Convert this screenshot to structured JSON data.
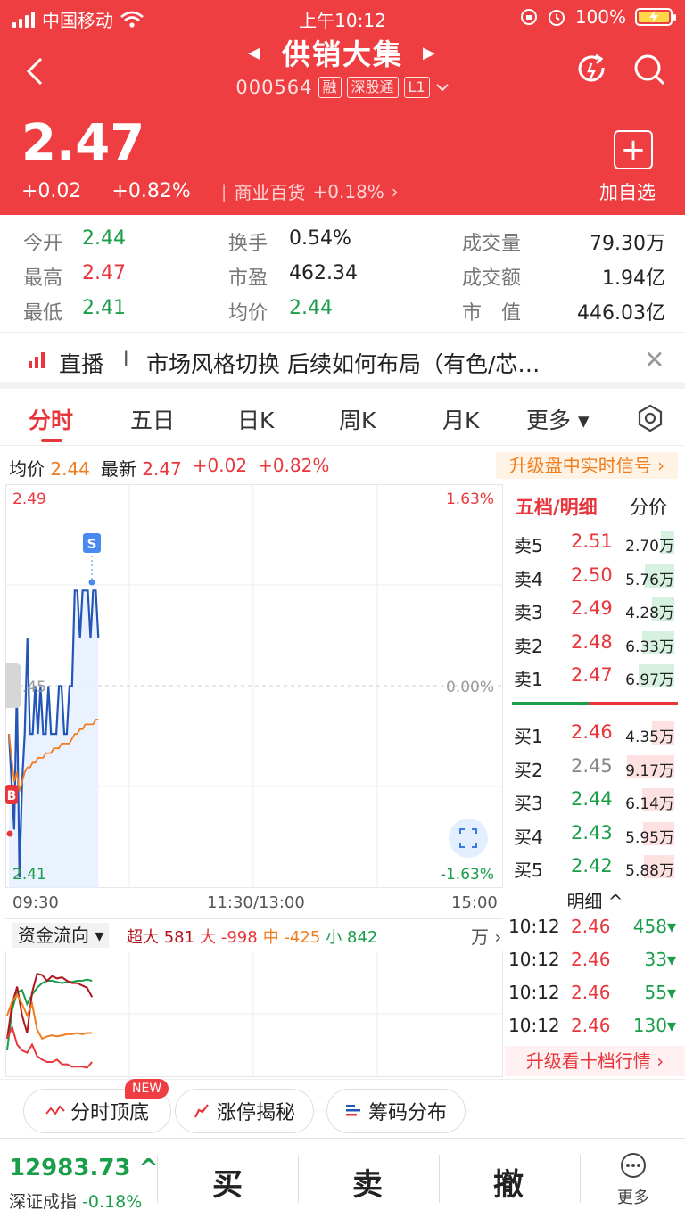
{
  "status": {
    "carrier": "中国移动",
    "time": "上午10:12",
    "battery": "100%"
  },
  "header": {
    "title": "供销大集",
    "code": "000564",
    "tags": [
      "融",
      "深股通",
      "L1"
    ],
    "price": "2.47",
    "change": "+0.02",
    "change_pct": "+0.82%",
    "sector": "商业百货",
    "sector_pct": "+0.18%",
    "add_label": "加自选",
    "add_glyph": "+"
  },
  "stats": [
    {
      "k": "今开",
      "v": "2.44",
      "color": "#1a9e4a"
    },
    {
      "k": "换手",
      "v": "0.54%",
      "color": "#222222"
    },
    {
      "k": "成交量",
      "v": "79.30万",
      "color": "#222222"
    },
    {
      "k": "最高",
      "v": "2.47",
      "color": "#e8363c"
    },
    {
      "k": "市盈",
      "v": "462.34",
      "color": "#222222"
    },
    {
      "k": "成交额",
      "v": "1.94亿",
      "color": "#222222"
    },
    {
      "k": "最低",
      "v": "2.41",
      "color": "#1a9e4a"
    },
    {
      "k": "均价",
      "v": "2.44",
      "color": "#1a9e4a"
    },
    {
      "k": "市　值",
      "v": "446.03亿",
      "color": "#222222"
    }
  ],
  "live": {
    "label": "直播",
    "text": "市场风格切换  后续如何布局（有色/芯…",
    "close": "✕"
  },
  "tabs": [
    "分时",
    "五日",
    "日K",
    "周K",
    "月K",
    "更多 ▾"
  ],
  "info": {
    "avg_label": "均价",
    "avg": "2.44",
    "last_label": "最新",
    "last": "2.47",
    "change": "+0.02",
    "change_pct": "+0.82%",
    "upgrade": "升级盘中实时信号 ›"
  },
  "chart_data": {
    "type": "line",
    "x_ticks": [
      "09:30",
      "11:30/13:00",
      "15:00"
    ],
    "y_labels": {
      "top": "2.49",
      "mid": "2.45",
      "bottom": "2.41"
    },
    "pct_labels": {
      "top": "1.63%",
      "mid": "0.00%",
      "bottom": "-1.63%"
    },
    "ylim": [
      2.41,
      2.49
    ],
    "grid": true,
    "markers": {
      "sell": "S",
      "buy": "B"
    },
    "series": [
      {
        "color": "#2456b8",
        "values": [
          2.44,
          2.43,
          2.42,
          2.45,
          2.41,
          2.43,
          2.44,
          2.46,
          2.44,
          2.44,
          2.45,
          2.44,
          2.45,
          2.44,
          2.44,
          2.45,
          2.44,
          2.44,
          2.44,
          2.45,
          2.45,
          2.44,
          2.44,
          2.45,
          2.45,
          2.47,
          2.47,
          2.46,
          2.47,
          2.47,
          2.47,
          2.46,
          2.47,
          2.47,
          2.46
        ]
      },
      {
        "color": "#f07d1e",
        "values": [
          2.44,
          2.435,
          2.43,
          2.432,
          2.428,
          2.43,
          2.432,
          2.433,
          2.433,
          2.434,
          2.434,
          2.435,
          2.435,
          2.435,
          2.436,
          2.436,
          2.436,
          2.437,
          2.437,
          2.437,
          2.438,
          2.438,
          2.438,
          2.438,
          2.439,
          2.44,
          2.44,
          2.441,
          2.441,
          2.442,
          2.442,
          2.442,
          2.442,
          2.443,
          2.443
        ]
      }
    ]
  },
  "book": {
    "header_left": "五档/明细",
    "header_right": "分价",
    "sells": [
      {
        "n": "卖5",
        "p": "2.51",
        "v": "2.70万",
        "frac": 0.25
      },
      {
        "n": "卖4",
        "p": "2.50",
        "v": "5.76万",
        "frac": 0.55
      },
      {
        "n": "卖3",
        "p": "2.49",
        "v": "4.28万",
        "frac": 0.42
      },
      {
        "n": "卖2",
        "p": "2.48",
        "v": "6.33万",
        "frac": 0.6
      },
      {
        "n": "卖1",
        "p": "2.47",
        "v": "6.97万",
        "frac": 0.66
      }
    ],
    "buys": [
      {
        "n": "买1",
        "p": "2.46",
        "v": "4.35万",
        "frac": 0.42
      },
      {
        "n": "买2",
        "p": "2.45",
        "v": "9.17万",
        "frac": 0.88
      },
      {
        "n": "买3",
        "p": "2.44",
        "v": "6.14万",
        "frac": 0.6
      },
      {
        "n": "买4",
        "p": "2.43",
        "v": "5.95万",
        "frac": 0.58
      },
      {
        "n": "买5",
        "p": "2.42",
        "v": "5.88万",
        "frac": 0.57
      }
    ],
    "detail_label": "明细 ^",
    "trades": [
      {
        "t": "10:12",
        "p": "2.46",
        "v": "458▾"
      },
      {
        "t": "10:12",
        "p": "2.46",
        "v": "33▾"
      },
      {
        "t": "10:12",
        "p": "2.46",
        "v": "55▾"
      },
      {
        "t": "10:12",
        "p": "2.46",
        "v": "130▾"
      }
    ],
    "upgrade": "升级看十档行情 ›"
  },
  "flow": {
    "select": "资金流向 ▾",
    "legend": [
      {
        "label": "超大",
        "value": "581",
        "color": "#b0161c"
      },
      {
        "label": "大",
        "value": "-998",
        "color": "#e8363c"
      },
      {
        "label": "中",
        "value": "-425",
        "color": "#f07d1e"
      },
      {
        "label": "小",
        "value": "842",
        "color": "#1a9e4a"
      }
    ],
    "unit": "万 ›",
    "series": [
      {
        "color": "#1a9e4a",
        "values": [
          0.2,
          0.55,
          0.7,
          0.72,
          0.6,
          0.68,
          0.74,
          0.78,
          0.8,
          0.8,
          0.79,
          0.78,
          0.79,
          0.79,
          0.8,
          0.8,
          0.81,
          0.8
        ]
      },
      {
        "color": "#b0161c",
        "values": [
          0.3,
          0.6,
          0.75,
          0.5,
          0.35,
          0.7,
          0.86,
          0.85,
          0.8,
          0.84,
          0.82,
          0.83,
          0.8,
          0.78,
          0.78,
          0.76,
          0.74,
          0.66
        ]
      },
      {
        "color": "#e8363c",
        "values": [
          0.3,
          0.4,
          0.25,
          0.2,
          0.18,
          0.25,
          0.15,
          0.12,
          0.1,
          0.1,
          0.12,
          0.08,
          0.08,
          0.06,
          0.06,
          0.06,
          0.05,
          0.1
        ]
      },
      {
        "color": "#f07d1e",
        "values": [
          0.5,
          0.62,
          0.68,
          0.6,
          0.5,
          0.6,
          0.38,
          0.3,
          0.32,
          0.33,
          0.32,
          0.33,
          0.34,
          0.34,
          0.35,
          0.34,
          0.35,
          0.35
        ]
      }
    ]
  },
  "tools": [
    {
      "label": "分时顶底",
      "icon": "chart-wave-icon"
    },
    {
      "label": "涨停揭秘",
      "icon": "limit-up-icon"
    },
    {
      "label": "筹码分布",
      "icon": "chip-distribution-icon"
    }
  ],
  "tools_badge": "NEW",
  "bottom": {
    "index_value": "12983.73 ^",
    "index_name": "深证成指",
    "index_pct": "-0.18%",
    "buy": "买",
    "sell": "卖",
    "cancel": "撤",
    "more": "更多"
  },
  "colors": {
    "brand": "#ef3e42",
    "up": "#e8363c",
    "down": "#1a9e4a",
    "avg_line": "#f07d1e",
    "price_line": "#2456b8"
  }
}
